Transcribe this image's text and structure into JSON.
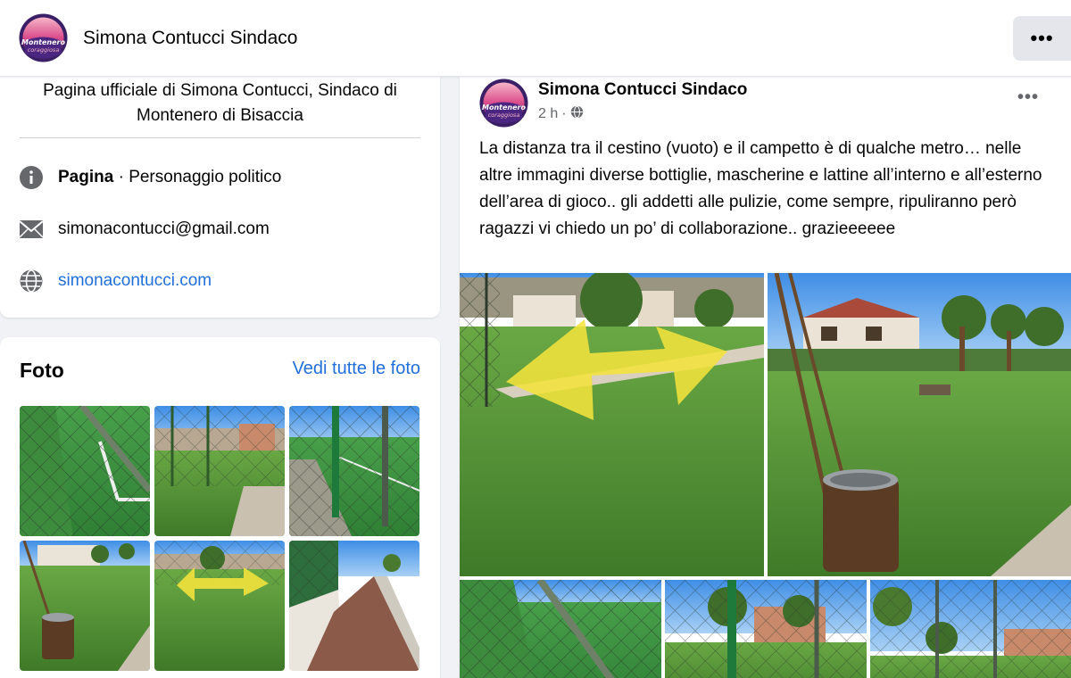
{
  "page": {
    "name": "Simona Contucci Sindaco",
    "logo_text_top": "Montenero",
    "logo_text_bottom": "coraggiosa",
    "more_label": "•••"
  },
  "intro": {
    "bio": "Pagina ufficiale di Simona Contucci, Sindaco di Montenero di Bisaccia",
    "category_prefix": "Pagina",
    "category_suffix": " · Personaggio politico",
    "email": "simonacontucci@gmail.com",
    "website": "simonacontucci.com"
  },
  "photos": {
    "title": "Foto",
    "see_all": "Vedi tutte le foto"
  },
  "post": {
    "author": "Simona Contucci Sindaco",
    "time": "2 h",
    "separator": "·",
    "more_label": "•••",
    "text": "La distanza tra il cestino (vuoto) e il campetto è di qualche metro… nelle altre immagini diverse bottiglie, mascherine e lattine all’interno e all’esterno dell’area di gioco.. gli addetti alle pulizie, come sempre, ripuliranno però ragazzi vi chiedo un po’ di collaborazione.. grazieeeeee"
  },
  "colors": {
    "link": "#216fdb",
    "grass": "#5a9a3a",
    "sky": "#4a90e2",
    "arrow": "#f2e23c",
    "logo_purple": "#5b2c8e",
    "logo_pink": "#d94c8a"
  }
}
